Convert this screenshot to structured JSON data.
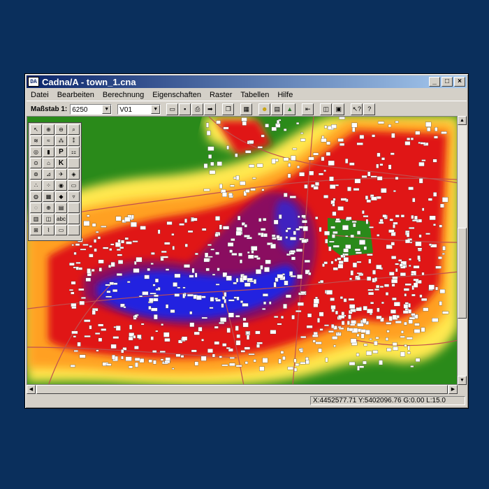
{
  "window": {
    "title": "Cadna/A - town_1.cna",
    "app_icon": "DA",
    "controls": [
      "_",
      "□",
      "×"
    ]
  },
  "menu": [
    "Datei",
    "Bearbeiten",
    "Berechnung",
    "Eigenschaften",
    "Raster",
    "Tabellen",
    "Hilfe"
  ],
  "toolbar": {
    "scale_label": "Maßstab 1:",
    "scale_value": "6250",
    "variant_value": "V01",
    "buttons": [
      "open-icon",
      "save-icon",
      "print-icon",
      "arrow-icon",
      "copy-icon",
      "calculator-icon",
      "smiley-icon",
      "grid-icon",
      "landscape-icon",
      "exit-icon",
      "map-icon",
      "picture-icon",
      "context-help-icon",
      "help-icon"
    ]
  },
  "palette": {
    "tools": [
      {
        "icon": "pointer-icon",
        "glyph": "↖"
      },
      {
        "icon": "zoom-in-icon",
        "glyph": "⊕"
      },
      {
        "icon": "zoom-out-icon",
        "glyph": "⊖"
      },
      {
        "icon": "zoom-window-icon",
        "glyph": "⌕"
      },
      {
        "icon": "point-source-icon",
        "glyph": "≋"
      },
      {
        "icon": "line-source-icon",
        "glyph": "≈"
      },
      {
        "icon": "area-source-icon",
        "glyph": "⁂"
      },
      {
        "icon": "dense-source-icon",
        "glyph": "⁑"
      },
      {
        "icon": "sound-icon",
        "glyph": "◎"
      },
      {
        "icon": "traffic-light-icon",
        "glyph": "▮"
      },
      {
        "icon": "parking-icon",
        "glyph": "P"
      },
      {
        "icon": "railway-icon",
        "glyph": "⚏"
      },
      {
        "icon": "speed-limit-icon",
        "glyph": "⊙"
      },
      {
        "icon": "road-icon",
        "glyph": "⌂"
      },
      {
        "icon": "keyword-icon",
        "glyph": "K"
      },
      {
        "icon": "empty-tool-icon",
        "glyph": ""
      },
      {
        "icon": "circle-icon",
        "glyph": "⊚"
      },
      {
        "icon": "edit-icon",
        "glyph": "⊿"
      },
      {
        "icon": "flight-icon",
        "glyph": "✈"
      },
      {
        "icon": "measure-icon",
        "glyph": "◈"
      },
      {
        "icon": "points-icon",
        "glyph": "∴"
      },
      {
        "icon": "scatter-icon",
        "glyph": "⁘"
      },
      {
        "icon": "target-icon",
        "glyph": "◉"
      },
      {
        "icon": "bus-icon",
        "glyph": "▭"
      },
      {
        "icon": "cylinder-icon",
        "glyph": "◍"
      },
      {
        "icon": "box-icon",
        "glyph": "▦"
      },
      {
        "icon": "highlight-icon",
        "glyph": "◆"
      },
      {
        "icon": "triangle-icon",
        "glyph": "▿"
      },
      {
        "icon": "ring-icon",
        "glyph": "◌"
      },
      {
        "icon": "globe-icon",
        "glyph": "⊕"
      },
      {
        "icon": "layers-icon",
        "glyph": "▤"
      },
      {
        "icon": "blank-icon",
        "glyph": ""
      },
      {
        "icon": "table-icon",
        "glyph": "▥"
      },
      {
        "icon": "db-icon",
        "glyph": "◫"
      },
      {
        "icon": "text-icon",
        "glyph": "abc"
      },
      {
        "icon": "blank2-icon",
        "glyph": ""
      },
      {
        "icon": "receiver-icon",
        "glyph": "⊞"
      },
      {
        "icon": "figure-icon",
        "glyph": "⌇"
      },
      {
        "icon": "sign-icon",
        "glyph": "▭"
      },
      {
        "icon": "blank3-icon",
        "glyph": ""
      }
    ]
  },
  "status": {
    "coordinates": "X:4452577.71 Y:5402096.76 G:0.00 L:15.0"
  },
  "colors": {
    "background": "#0a2f5c",
    "low_level": "#2a8a1a",
    "medium_low": "#ffe850",
    "medium": "#ffa020",
    "high": "#e01818",
    "very_high": "#8a1060",
    "highest": "#2020e0",
    "buildings": "#ffffff"
  }
}
